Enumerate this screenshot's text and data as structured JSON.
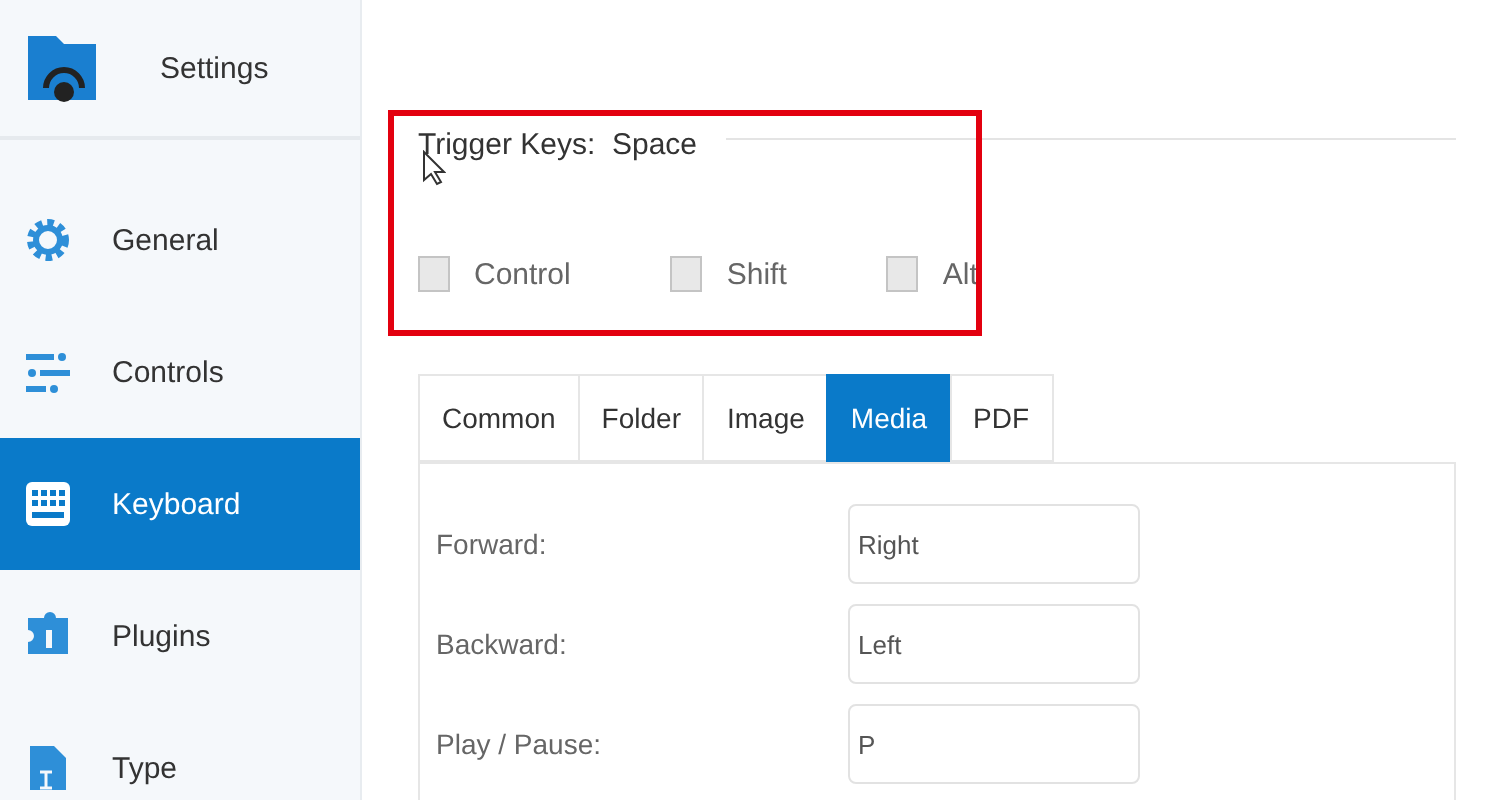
{
  "sidebar": {
    "title": "Settings",
    "items": [
      {
        "label": "General",
        "kind": "gear",
        "selected": false
      },
      {
        "label": "Controls",
        "kind": "sliders",
        "selected": false
      },
      {
        "label": "Keyboard",
        "kind": "keyboard",
        "selected": true
      },
      {
        "label": "Plugins",
        "kind": "puzzle",
        "selected": false
      },
      {
        "label": "Type",
        "kind": "file",
        "selected": false
      }
    ]
  },
  "trigger": {
    "label": "Trigger Keys:",
    "value": "Space",
    "highlighted": true,
    "modifiers": [
      {
        "label": "Control",
        "checked": false
      },
      {
        "label": "Shift",
        "checked": false
      },
      {
        "label": "Alt",
        "checked": false
      }
    ]
  },
  "tabs": [
    {
      "label": "Common",
      "selected": false
    },
    {
      "label": "Folder",
      "selected": false
    },
    {
      "label": "Image",
      "selected": false
    },
    {
      "label": "Media",
      "selected": true
    },
    {
      "label": "PDF",
      "selected": false
    }
  ],
  "shortcuts": [
    {
      "label": "Forward:",
      "value": "Right"
    },
    {
      "label": "Backward:",
      "value": "Left"
    },
    {
      "label": "Play / Pause:",
      "value": "P"
    }
  ]
}
